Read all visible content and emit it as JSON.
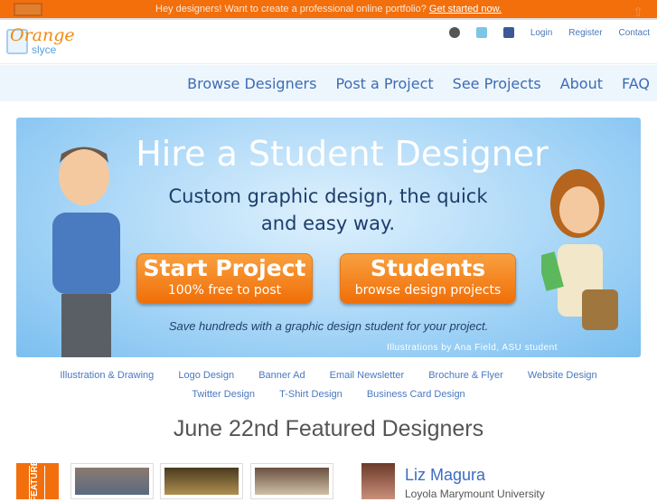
{
  "topbar": {
    "message": "Hey designers! Want to create a professional online portfolio?",
    "link": "Get started now."
  },
  "logo": {
    "line1": "Orange",
    "line2": "slyce"
  },
  "toplinks": {
    "login": "Login",
    "register": "Register",
    "contact": "Contact"
  },
  "nav": [
    "Browse Designers",
    "Post a Project",
    "See Projects",
    "About",
    "FAQ"
  ],
  "hero": {
    "title": "Hire a Student Designer",
    "subtitle1": "Custom graphic design, the quick",
    "subtitle2": "and easy way.",
    "start_title": "Start Project",
    "start_sub": "100% free to post",
    "students_title": "Students",
    "students_sub": "browse design projects",
    "tagline": "Save hundreds with a graphic design student for your project.",
    "credit": "Illustrations by Ana Field, ASU student"
  },
  "categories": [
    "Illustration & Drawing",
    "Logo Design",
    "Banner Ad",
    "Email Newsletter",
    "Brochure & Flyer",
    "Website Design",
    "Twitter Design",
    "T-Shirt Design",
    "Business Card Design"
  ],
  "featured": {
    "title": "June 22nd Featured Designers",
    "ribbon": "FEATURED",
    "designer_name": "Liz Magura",
    "designer_school": "Loyola Marymount University"
  }
}
